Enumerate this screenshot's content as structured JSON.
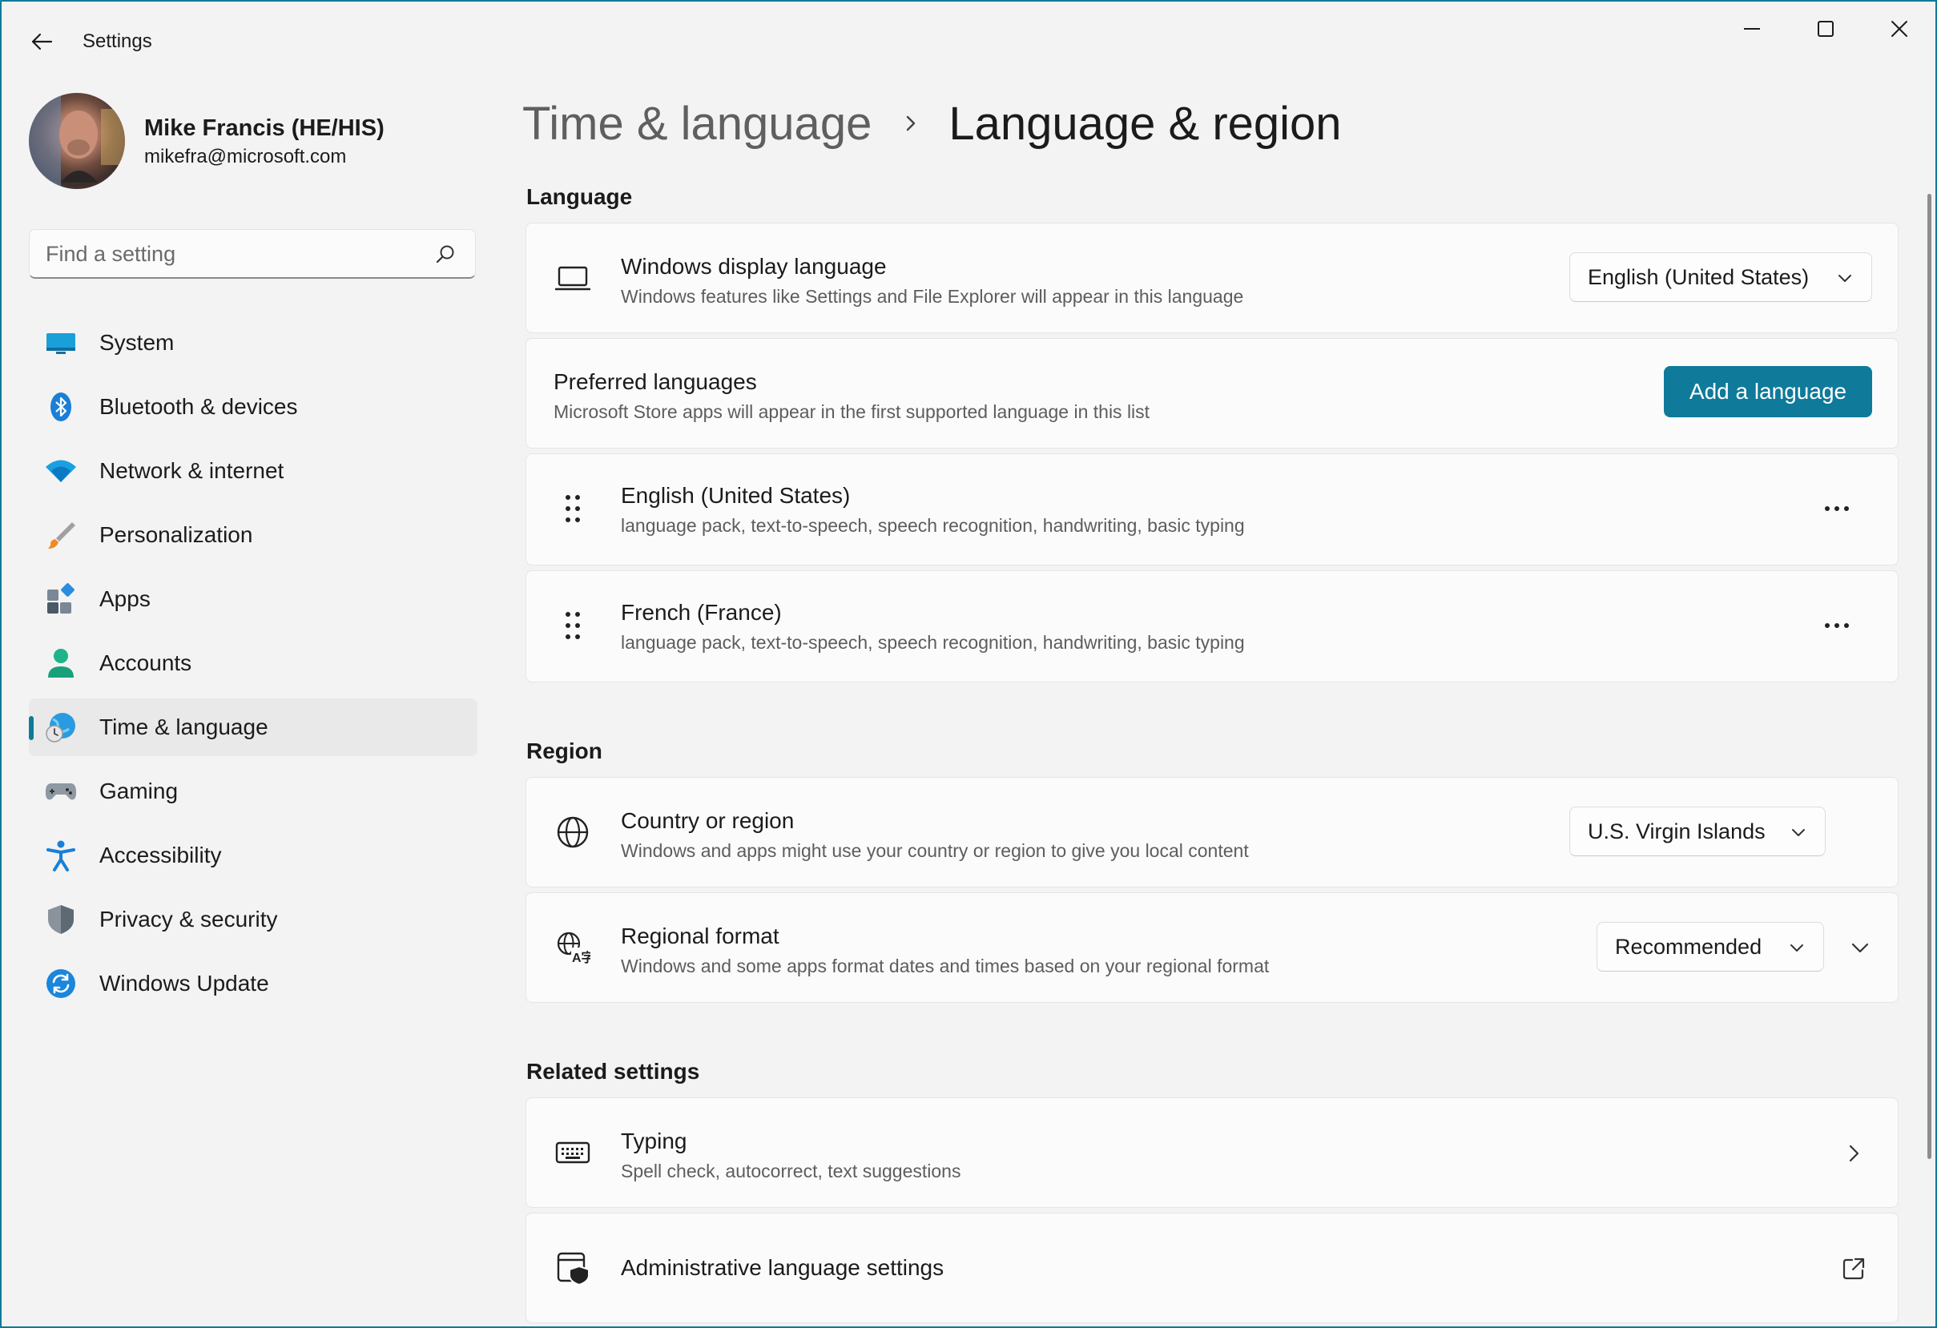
{
  "window": {
    "title": "Settings",
    "accent_color": "#0f7a9a"
  },
  "profile": {
    "name": "Mike Francis (HE/HIS)",
    "email": "mikefra@microsoft.com"
  },
  "search": {
    "placeholder": "Find a setting"
  },
  "sidebar": {
    "items": [
      {
        "label": "System",
        "icon": "monitor-icon",
        "selected": false
      },
      {
        "label": "Bluetooth & devices",
        "icon": "bluetooth-icon",
        "selected": false
      },
      {
        "label": "Network & internet",
        "icon": "wifi-icon",
        "selected": false
      },
      {
        "label": "Personalization",
        "icon": "brush-icon",
        "selected": false
      },
      {
        "label": "Apps",
        "icon": "apps-icon",
        "selected": false
      },
      {
        "label": "Accounts",
        "icon": "person-icon",
        "selected": false
      },
      {
        "label": "Time & language",
        "icon": "globe-clock-icon",
        "selected": true
      },
      {
        "label": "Gaming",
        "icon": "gamepad-icon",
        "selected": false
      },
      {
        "label": "Accessibility",
        "icon": "accessibility-icon",
        "selected": false
      },
      {
        "label": "Privacy & security",
        "icon": "shield-icon",
        "selected": false
      },
      {
        "label": "Windows Update",
        "icon": "update-icon",
        "selected": false
      }
    ]
  },
  "breadcrumb": {
    "parent": "Time & language",
    "current": "Language & region"
  },
  "language": {
    "section_title": "Language",
    "display_language": {
      "title": "Windows display language",
      "description": "Windows features like Settings and File Explorer will appear in this language",
      "value": "English (United States)"
    },
    "preferred": {
      "title": "Preferred languages",
      "description": "Microsoft Store apps will appear in the first supported language in this list",
      "button_label": "Add a language"
    },
    "languages": [
      {
        "name": "English (United States)",
        "features": "language pack, text-to-speech, speech recognition, handwriting, basic typing"
      },
      {
        "name": "French (France)",
        "features": "language pack, text-to-speech, speech recognition, handwriting, basic typing"
      }
    ]
  },
  "region": {
    "section_title": "Region",
    "country": {
      "title": "Country or region",
      "description": "Windows and apps might use your country or region to give you local content",
      "value": "U.S. Virgin Islands"
    },
    "format": {
      "title": "Regional format",
      "description": "Windows and some apps format dates and times based on your regional format",
      "value": "Recommended"
    }
  },
  "related": {
    "section_title": "Related settings",
    "typing": {
      "title": "Typing",
      "description": "Spell check, autocorrect, text suggestions"
    },
    "admin": {
      "title": "Administrative language settings"
    }
  }
}
